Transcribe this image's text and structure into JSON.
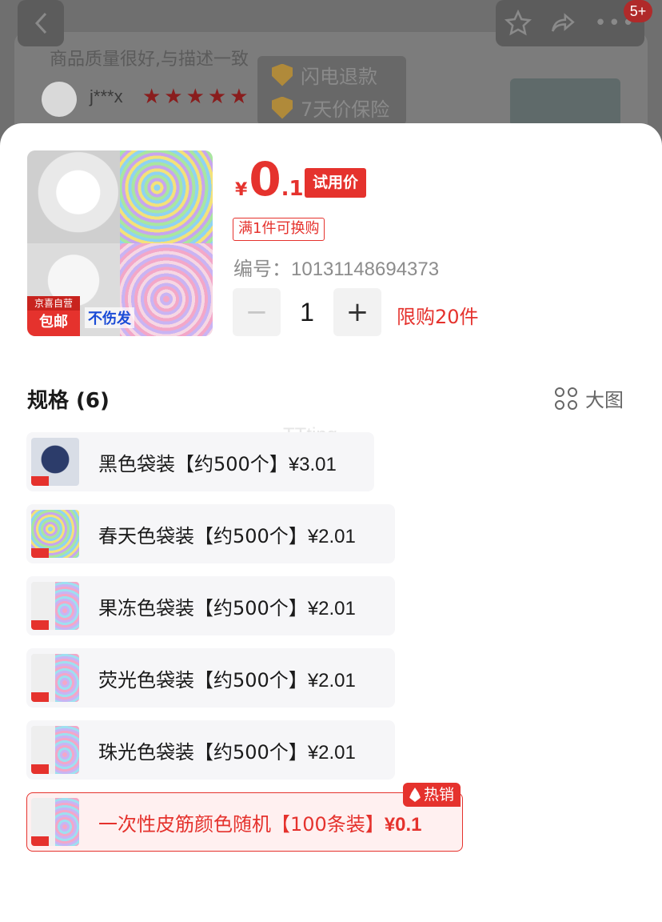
{
  "background": {
    "badge": "5+",
    "review_text": "商品质量很好,与描述一致",
    "reviewer": "j***x",
    "stars": "★★★★★",
    "guarantee": [
      "闪电退款",
      "7天价保险"
    ]
  },
  "product": {
    "image_tag_top": "京喜自营",
    "image_tag_bottom": "包邮",
    "image_caption": "不伤发",
    "currency": "¥",
    "price_int": "0",
    "price_dec": ".1",
    "trial_label": "试用价",
    "promo": "满1件可换购",
    "sku_label": "编号：",
    "sku_number": "10131148694373",
    "quantity": "1",
    "limit": "限购20件"
  },
  "specs": {
    "title": "规格 (6)",
    "big_view": "大图",
    "watermark": "TTting",
    "hot_label": "热销",
    "options": [
      {
        "label": "黑色袋装【约500个】",
        "price": "¥3.01"
      },
      {
        "label": "春天色袋装【约500个】",
        "price": "¥2.01"
      },
      {
        "label": "果冻色袋装【约500个】",
        "price": "¥2.01"
      },
      {
        "label": "荧光色袋装【约500个】",
        "price": "¥2.01"
      },
      {
        "label": "珠光色袋装【约500个】",
        "price": "¥2.01"
      },
      {
        "label": "一次性皮筋颜色随机【100条装】",
        "price": "¥0.1"
      }
    ]
  },
  "colors": {
    "accent": "#e5322d"
  }
}
